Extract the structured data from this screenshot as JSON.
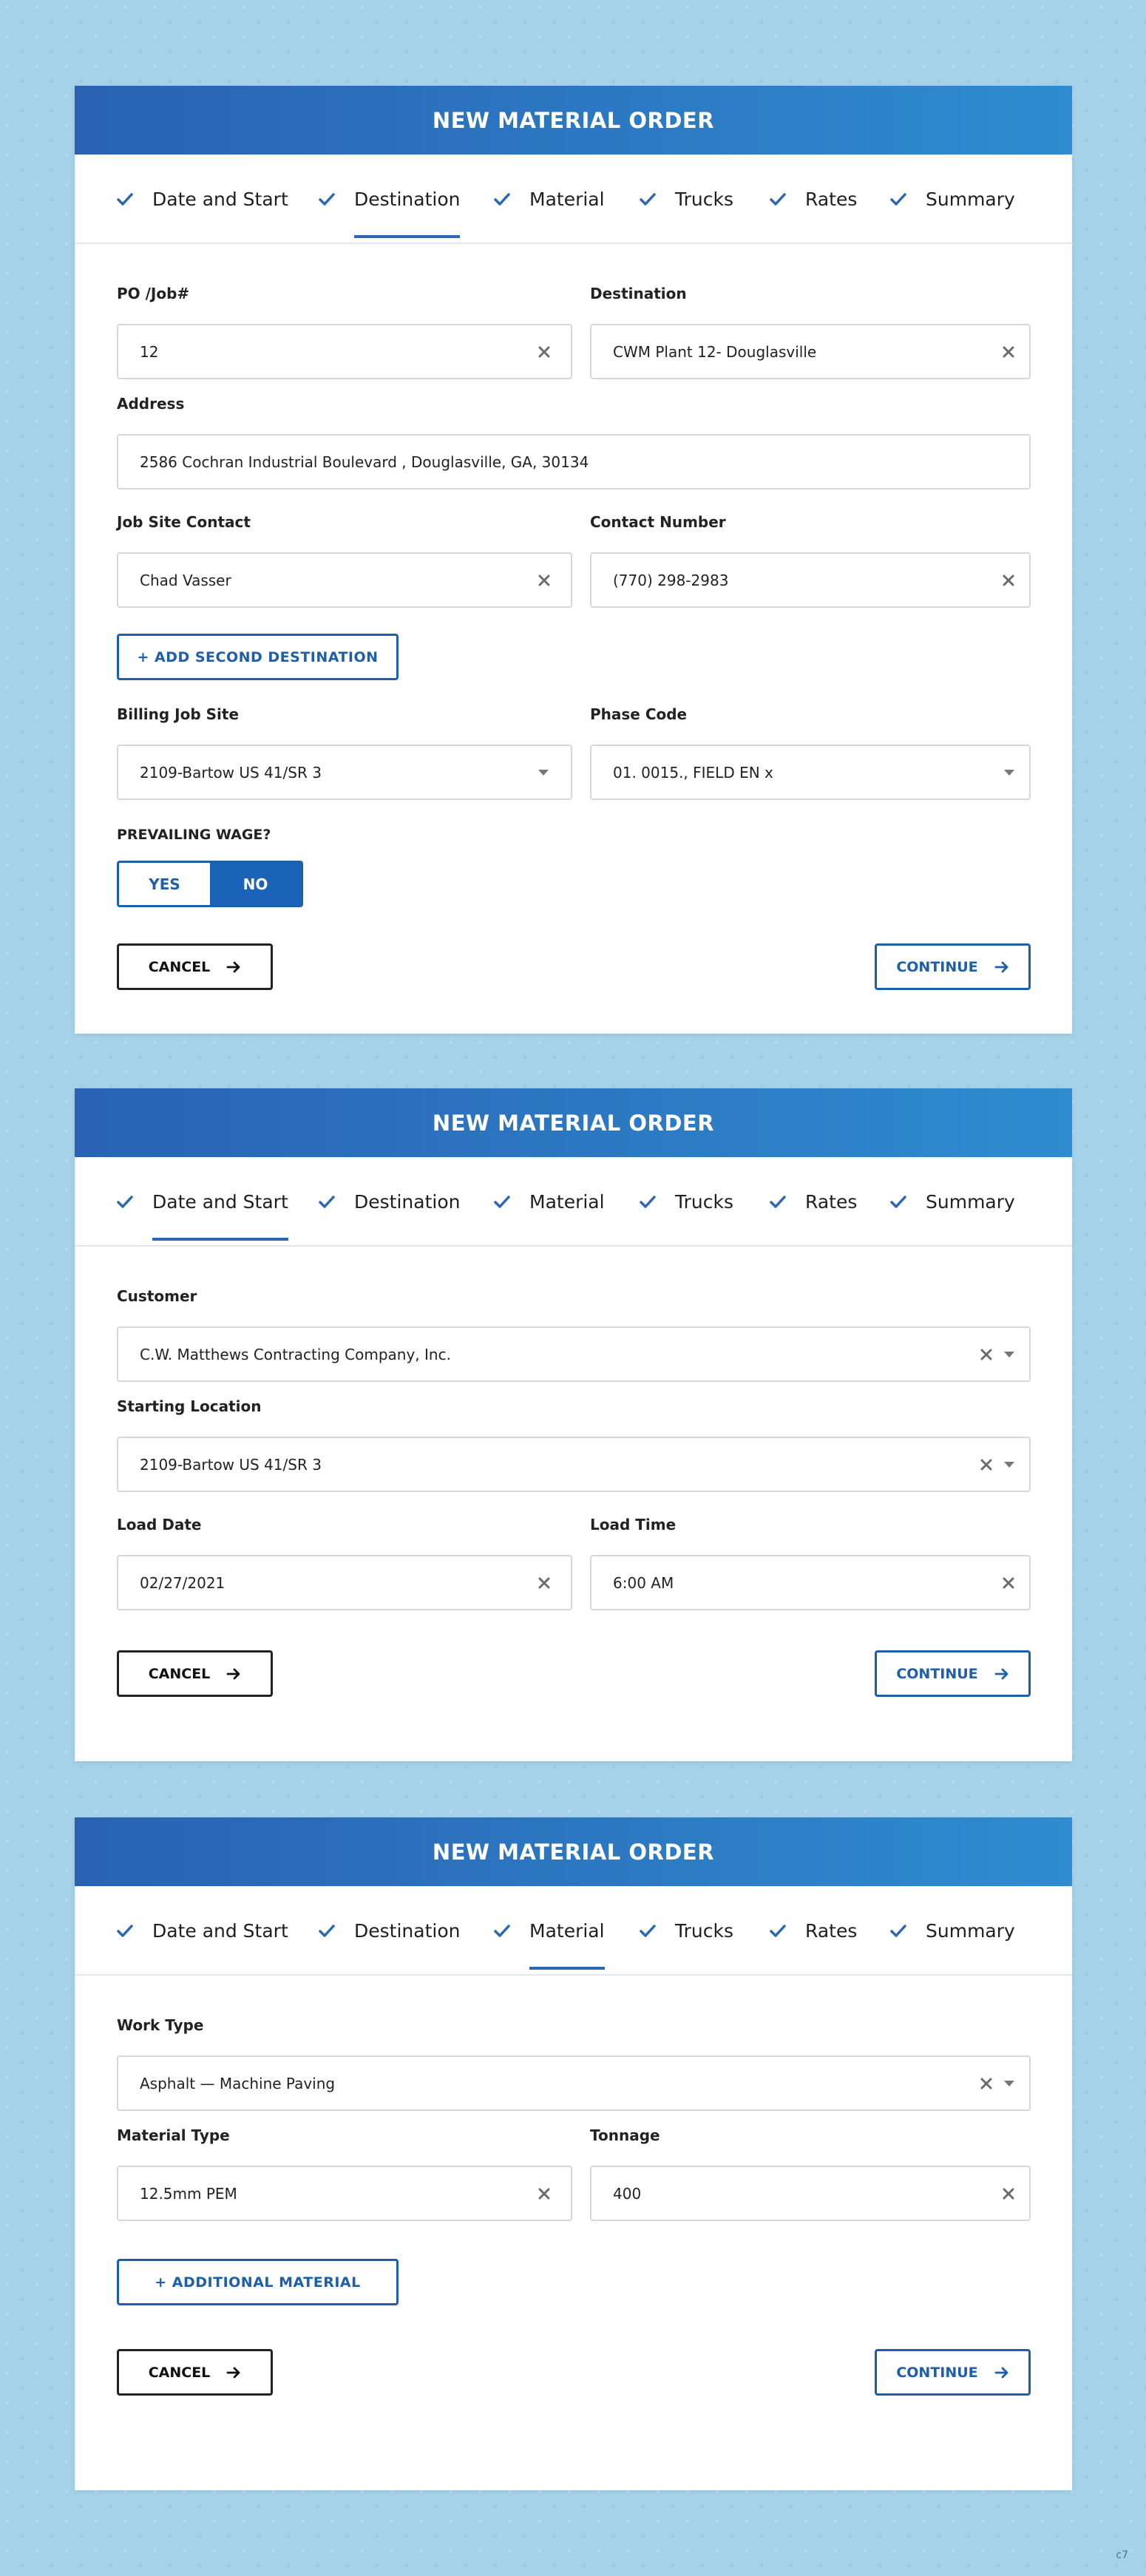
{
  "colors": {
    "background": "#a5d2e8",
    "header_gradient_start": "#2a62b3",
    "header_gradient_end": "#2e8ccf",
    "accent": "#1f5ea8",
    "toggle_active": "#1a63b8"
  },
  "steps_labels": [
    "Date and Start",
    "Destination",
    "Material",
    "Trucks",
    "Rates",
    "Summary"
  ],
  "buttons": {
    "cancel": "CANCEL",
    "continue": "CONTINUE"
  },
  "card_destination": {
    "title": "NEW MATERIAL ORDER",
    "active_step": "Destination",
    "steps": [
      "Date and Start",
      "Destination",
      "Material",
      "Trucks",
      "Rates",
      "Summary"
    ],
    "po_label": "PO /Job#",
    "po_value": "12",
    "destination_label": "Destination",
    "destination_value": "CWM Plant 12- Douglasville",
    "address_label": "Address",
    "address_value": "2586 Cochran Industrial Boulevard , Douglasville, GA, 30134",
    "contact_label": "Job Site Contact",
    "contact_value": "Chad Vasser",
    "contact_number_label": "Contact Number",
    "contact_number_value": "(770) 298-2983",
    "add_destination": "+ ADD SECOND DESTINATION",
    "billing_label": "Billing Job Site",
    "billing_value": "2109-Bartow US 41/SR 3",
    "phase_label": "Phase Code",
    "phase_value": "01. 0015., FIELD EN x",
    "wage_label": "PREVAILING WAGE?",
    "wage_yes": "YES",
    "wage_no": "NO",
    "wage_selected": "NO"
  },
  "card_date": {
    "title": "NEW MATERIAL ORDER",
    "active_step": "Date and Start",
    "steps": [
      "Date and Start",
      "Destination",
      "Material",
      "Trucks",
      "Rates",
      "Summary"
    ],
    "customer_label": "Customer",
    "customer_value": "C.W. Matthews Contracting Company, Inc.",
    "location_label": "Starting Location",
    "location_value": "2109-Bartow US 41/SR 3",
    "load_date_label": "Load Date",
    "load_date_value": "02/27/2021",
    "load_time_label": "Load Time",
    "load_time_value": "6:00 AM"
  },
  "card_material": {
    "title": "NEW MATERIAL ORDER",
    "active_step": "Material",
    "steps": [
      "Date and Start",
      "Destination",
      "Material",
      "Trucks",
      "Rates",
      "Summary"
    ],
    "work_type_label": "Work Type",
    "work_type_value": "Asphalt — Machine Paving",
    "material_type_label": "Material Type",
    "material_type_value": "12.5mm PEM",
    "tonnage_label": "Tonnage",
    "tonnage_value": "400",
    "add_material": "+ ADDITIONAL MATERIAL"
  },
  "corner_mark": "c7"
}
